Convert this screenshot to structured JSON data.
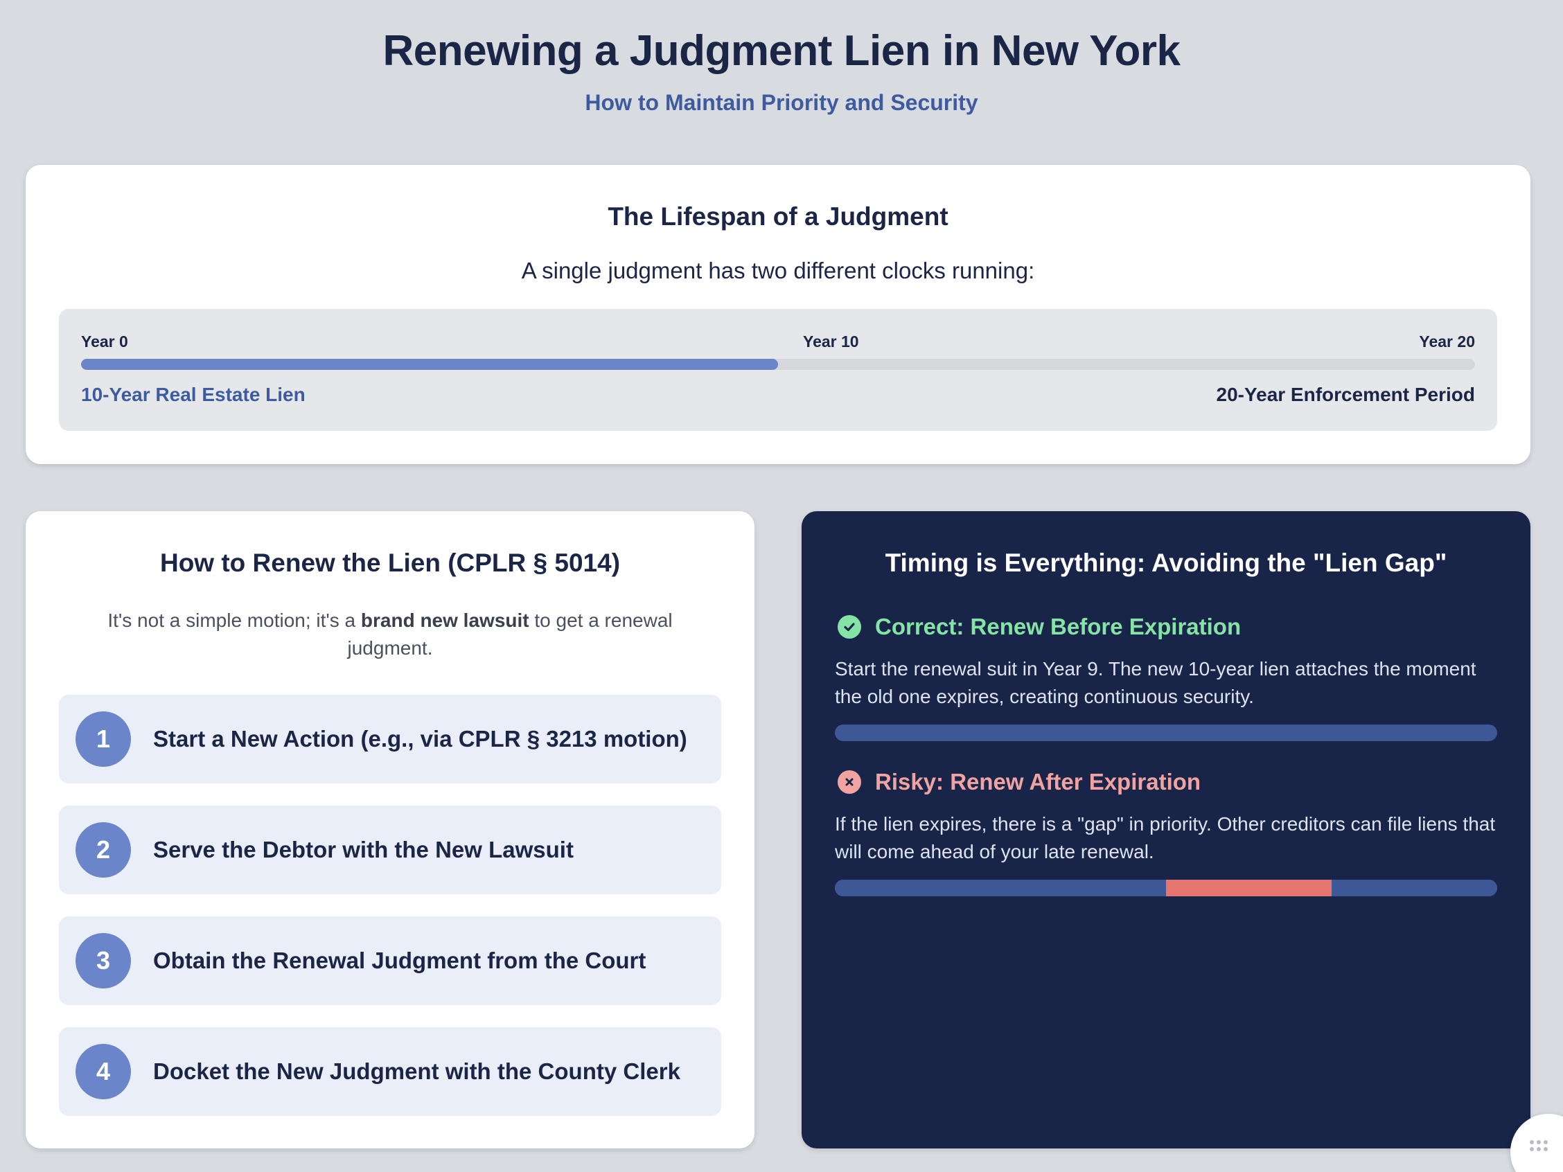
{
  "header": {
    "title": "Renewing a Judgment Lien in New York",
    "subtitle": "How to Maintain Priority and Security"
  },
  "lifespan": {
    "title": "The Lifespan of a Judgment",
    "description": "A single judgment has two different clocks running:",
    "ticks": {
      "start": "Year 0",
      "mid": "Year 10",
      "end": "Year 20"
    },
    "lien_label": "10-Year Real Estate Lien",
    "enforcement_label": "20-Year Enforcement Period",
    "lien_years": 10,
    "enforcement_years": 20,
    "colors": {
      "lien_fill": "#6a85c9",
      "track": "#d5d7dc"
    }
  },
  "renew": {
    "title": "How to Renew the Lien (CPLR § 5014)",
    "desc_before": "It's not a simple motion; it's a ",
    "desc_bold": "brand new lawsuit",
    "desc_after": " to get a renewal judgment.",
    "steps": [
      {
        "num": "1",
        "text": "Start a New Action (e.g., via CPLR § 3213 motion)"
      },
      {
        "num": "2",
        "text": "Serve the Debtor with the New Lawsuit"
      },
      {
        "num": "3",
        "text": "Obtain the Renewal Judgment from the Court"
      },
      {
        "num": "4",
        "text": "Docket the New Judgment with the County Clerk"
      }
    ]
  },
  "timing": {
    "title": "Timing is Everything: Avoiding the \"Lien Gap\"",
    "correct": {
      "icon": "check-circle-icon",
      "heading": "Correct: Renew Before Expiration",
      "body": "Start the renewal suit in Year 9. The new 10-year lien attaches the moment the old one expires, creating continuous security.",
      "bar_gap_fraction": 0
    },
    "risky": {
      "icon": "x-circle-icon",
      "heading": "Risky: Renew After Expiration",
      "body": "If the lien expires, there is a \"gap\" in priority. Other creditors can file liens that will come ahead of your late renewal.",
      "bar_segments": [
        0.5,
        0.25,
        0.25
      ]
    },
    "colors": {
      "success": "#86e3a6",
      "danger": "#f0a3a0",
      "gap": "#e4766f",
      "covered": "#3d5797",
      "background": "#182448"
    }
  }
}
